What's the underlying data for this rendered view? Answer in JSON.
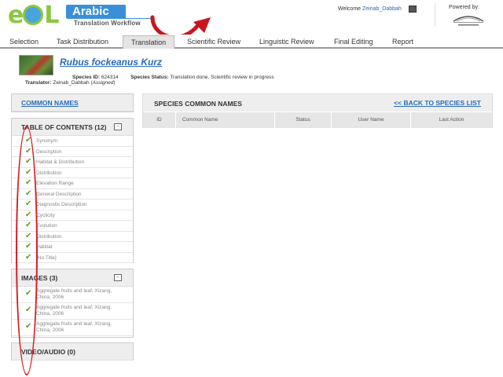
{
  "header": {
    "logo_main": "eol",
    "logo_arabic": "Arabic",
    "logo_sub": "Translation Workflow",
    "welcome_label": "Welcome",
    "user_name": "Zeinab_Dabbah",
    "powered_by": "Powered by:"
  },
  "nav": {
    "tabs": [
      {
        "label": "Selection"
      },
      {
        "label": "Task Distribution"
      },
      {
        "label": "Translation"
      },
      {
        "label": "Scientific Review"
      },
      {
        "label": "Linguistic Review"
      },
      {
        "label": "Final Editing"
      },
      {
        "label": "Report"
      }
    ]
  },
  "species": {
    "title": "Rubus fockeanus Kurz",
    "id_label": "Species ID:",
    "id_value": "624314",
    "status_label": "Species Status:",
    "status_value": "Translation done, Scientific review in progress",
    "translator_label": "Translator:",
    "translator_name": "Zeinab_Dabbah",
    "translator_state": "Assigned"
  },
  "sidebar": {
    "common_names": "COMMON NAMES",
    "toc_title": "TABLE OF CONTENTS (12)",
    "toc_items": [
      {
        "label": "Synonym"
      },
      {
        "label": "Description"
      },
      {
        "label": "Habitat & Distribution"
      },
      {
        "label": "Distribution"
      },
      {
        "label": "Elevation Range"
      },
      {
        "label": "General Description"
      },
      {
        "label": "Diagnostic Description"
      },
      {
        "label": "Cyclicity"
      },
      {
        "label": "Evolution"
      },
      {
        "label": "Distribution"
      },
      {
        "label": "Habitat"
      },
      {
        "label": "[No Title]"
      }
    ],
    "images_title": "IMAGES (3)",
    "image_items": [
      {
        "line1": "Aggregate fruits and leaf, Xizang,",
        "line2": "China, 2006"
      },
      {
        "line1": "Aggregate fruits and leaf, Xizang,",
        "line2": "China, 2006"
      },
      {
        "line1": "Aggregate fruits and leaf, Xizang,",
        "line2": "China, 2006"
      }
    ],
    "video_title": "VIDEO/AUDIO (0)",
    "toggle_symbol": "-"
  },
  "main": {
    "title": "SPECIES COMMON NAMES",
    "back_link": "<< BACK TO SPECIES LIST",
    "columns": [
      "ID",
      "Common Name",
      "Status",
      "User Name",
      "Last Action"
    ]
  },
  "colors": {
    "link_blue": "#2a6ab7",
    "check_green": "#5aa02c",
    "annotation_red": "#d21f26",
    "logo_green": "#8cc63f",
    "logo_blue": "#3a8fd9"
  },
  "icons": {
    "check": "check-icon",
    "toggle": "collapse-icon",
    "arrow": "curved-arrow-annotation"
  }
}
